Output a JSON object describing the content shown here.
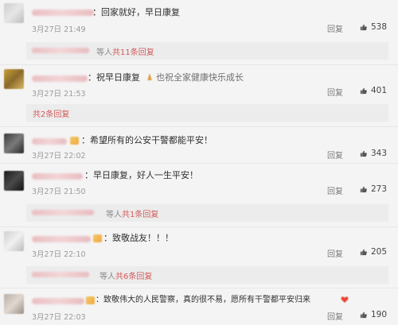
{
  "labels": {
    "reply": "回复"
  },
  "comments": [
    {
      "text": "：回家就好，早日康复",
      "time": "3月27日 21:49",
      "likes": "538",
      "replies": {
        "prefix": "等人",
        "link": "共11条回复"
      }
    },
    {
      "text": "：祝早日康复",
      "text_after_emoji": "也祝全家健康快乐成长",
      "time": "3月27日 21:53",
      "likes": "401",
      "replies": {
        "prefix": "",
        "link": "共2条回复"
      }
    },
    {
      "text": "：希望所有的公安干警都能平安！",
      "time": "3月27日 22:02",
      "likes": "343"
    },
    {
      "text": "：早日康复，好人一生平安！",
      "time": "3月27日 21:50",
      "likes": "273",
      "replies": {
        "prefix": "等人",
        "link": "共1条回复"
      }
    },
    {
      "text": "：致敬战友！！！",
      "time": "3月27日 22:10",
      "likes": "205",
      "replies": {
        "prefix": "等人",
        "link": "共6条回复"
      }
    },
    {
      "text": "：致敬伟大的人民警察，真的很不易，愿所有干警都平安归来",
      "time": "3月27日 22:03",
      "likes": "190"
    }
  ],
  "colors": {
    "accent": "#d35a5a",
    "muted": "#8a8a8a",
    "background": "#f4f4f4"
  },
  "icons": {
    "like": "thumb-up-icon",
    "emoji_pray": "praying-hands-emoji",
    "emoji_heart": "heart-emoji"
  }
}
